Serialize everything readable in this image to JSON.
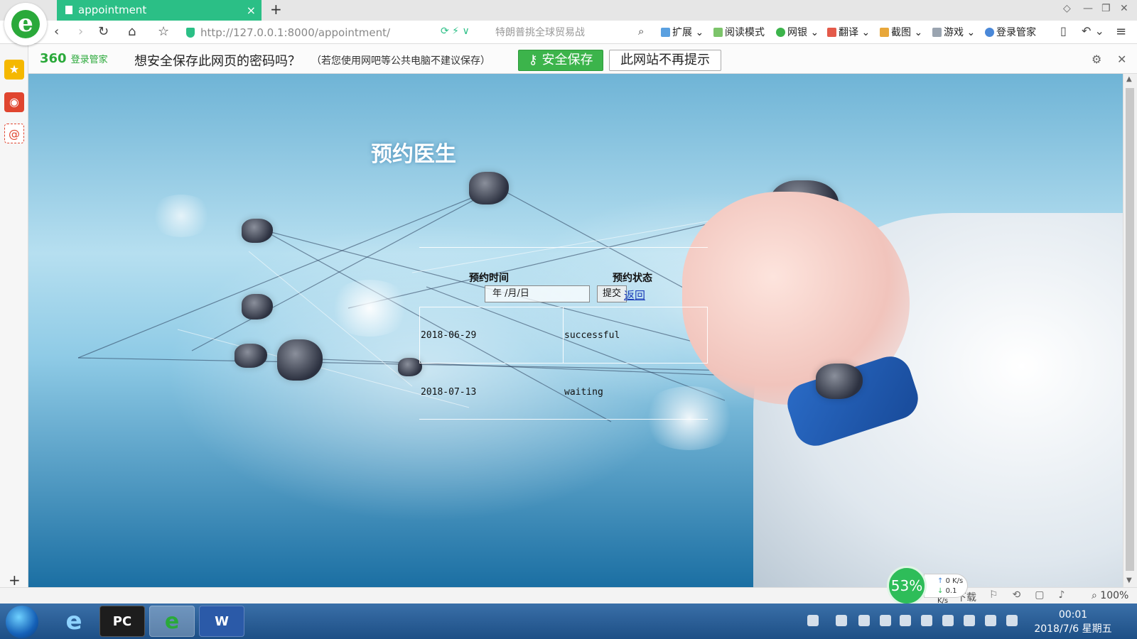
{
  "browser": {
    "tab_title": "appointment",
    "tab_close": "×",
    "new_tab": "+",
    "url_host": "http://127.0.0.1",
    "url_path": ":8000/appointment/",
    "search_placeholder": "特朗普挑全球贸易战",
    "toolbar": [
      "扩展",
      "阅读模式",
      "网银",
      "翻译",
      "截图",
      "游戏",
      "登录管家"
    ]
  },
  "password_bar": {
    "brand": "360",
    "brand_sub": "登录管家",
    "question": "想安全保存此网页的密码吗？",
    "hint": "（若您使用网吧等公共电脑不建议保存）",
    "save_button": "安全保存",
    "never_button": "此网站不再提示"
  },
  "page": {
    "title": "预约医生",
    "col_time": "预约时间",
    "col_status": "预约状态",
    "date_placeholder": "年 /月/日",
    "submit": "提交",
    "back": "返回",
    "rows": [
      {
        "date": "2018-06-29",
        "status": "successful"
      },
      {
        "date": "2018-07-13",
        "status": "waiting"
      }
    ]
  },
  "status": {
    "net_percent": "53%",
    "up_speed": "0 K/s",
    "down_speed": "0.1 K/s",
    "zoom": "100%",
    "download_label": "下载"
  },
  "taskbar": {
    "time": "00:01",
    "date": "2018/7/6 星期五"
  }
}
